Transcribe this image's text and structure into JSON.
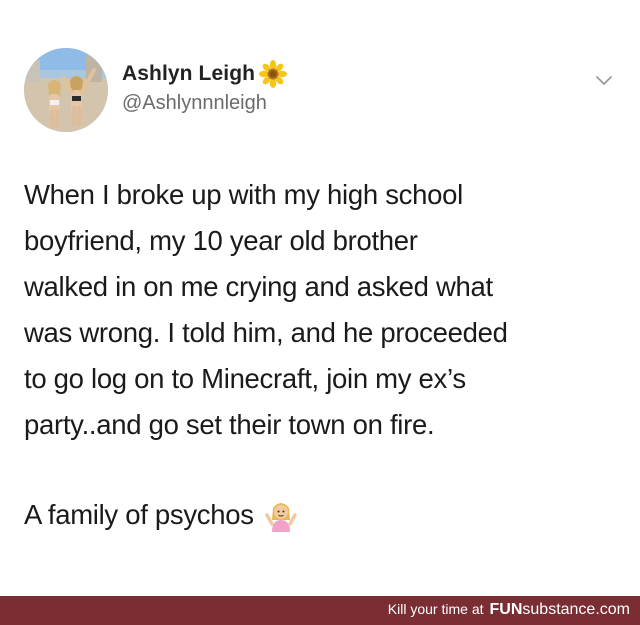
{
  "tweet": {
    "display_name": "Ashlyn Leigh",
    "handle": "@Ashlynnnleigh",
    "text": "When I broke up with my high school\nboyfriend, my 10 year old brother\nwalked in on me crying and asked what\nwas wrong. I told him, and he proceeded\nto go log on to Minecraft, join my ex’s\nparty..and go set their town on fire.",
    "closing_line": "A family of psychos",
    "icons": {
      "name_emoji": "sunflower-icon",
      "closing_emoji": "shrug-icon",
      "menu": "chevron-down-icon"
    }
  },
  "footer": {
    "prefix": "Kill your time at",
    "brand_bold": "FUN",
    "brand_rest": "substance.com"
  },
  "colors": {
    "footer_bg": "#7a2e34",
    "handle": "#6b6b6b",
    "text": "#1a1a1a"
  }
}
